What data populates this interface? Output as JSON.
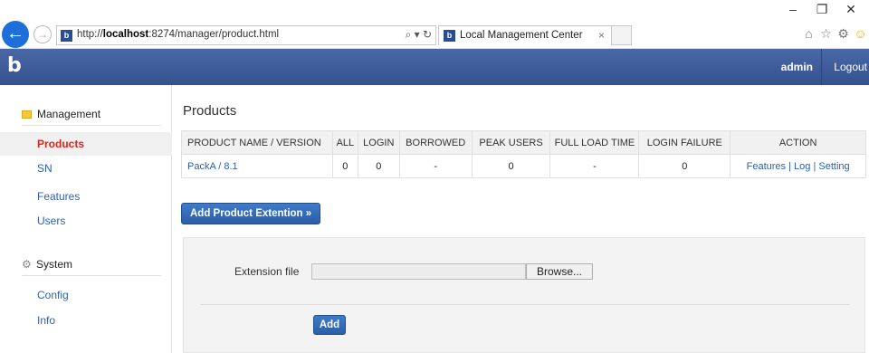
{
  "browser": {
    "address_prefix": "http://",
    "address_host": "localhost",
    "address_rest": ":8274/manager/product.html",
    "address_actions": "⌕ ▾ ↻",
    "tab_title": "Local Management Center",
    "tab_close": "×",
    "favicon_glyph": "b",
    "back_glyph": "←",
    "forward_glyph": "→",
    "window_minimize": "–",
    "window_restore": "❐",
    "window_close": "✕",
    "home_glyph": "⌂",
    "favorites_glyph": "☆",
    "settings_glyph": "⚙",
    "smiley_glyph": "☺"
  },
  "header": {
    "logo": "b",
    "user": "admin",
    "logout": "Logout",
    "bg_color": "#3b5998"
  },
  "sidebar": {
    "management_label": "Management",
    "management_items": [
      {
        "label": "Products",
        "active": true
      },
      {
        "label": "SN"
      },
      {
        "label": "Features"
      },
      {
        "label": "Users"
      }
    ],
    "system_label": "System",
    "system_items": [
      {
        "label": "Config"
      },
      {
        "label": "Info"
      }
    ],
    "active_color": "#e2231a",
    "link_color": "#3060b0"
  },
  "main": {
    "title": "Products",
    "table": {
      "headers": [
        "PRODUCT NAME / VERSION",
        "ALL",
        "LOGIN",
        "BORROWED",
        "PEAK USERS",
        "FULL LOAD TIME",
        "LOGIN FAILURE",
        "ACTION"
      ],
      "rows": [
        {
          "name": "PackA / 8.1",
          "all": "0",
          "login": "0",
          "borrowed": "-",
          "peak_users": "0",
          "full_load_time": "-",
          "login_failure": "0",
          "action_features": "Features",
          "action_sep1": " | ",
          "action_log": "Log",
          "action_sep2": " | ",
          "action_setting": "Setting"
        }
      ]
    },
    "add_extension_button": "Add Product Extention »",
    "upload": {
      "label": "Extension file",
      "file_value": "",
      "browse_label": "Browse...",
      "add_label": "Add"
    }
  }
}
